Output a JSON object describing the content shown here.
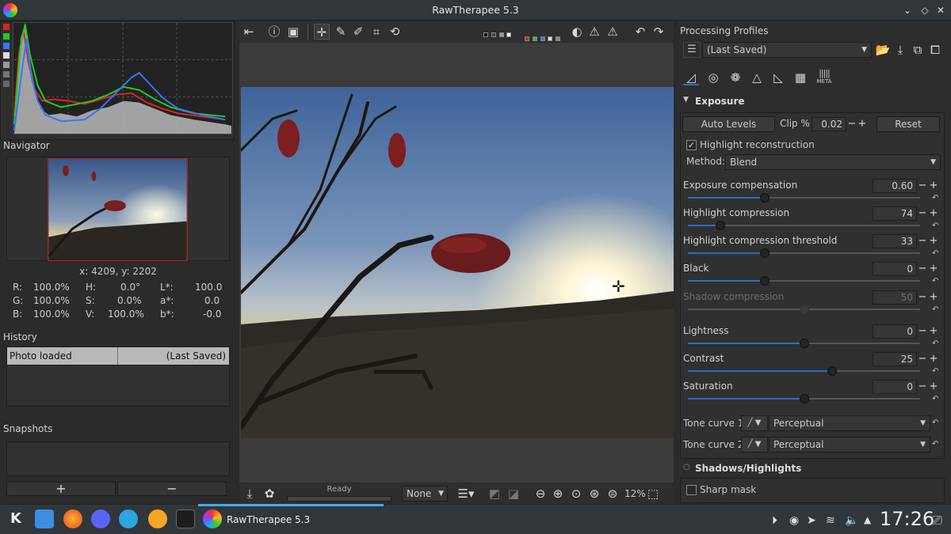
{
  "window": {
    "title": "RawTherapee 5.3"
  },
  "left": {
    "navigator_label": "Navigator",
    "coords": "x: 4209, y: 2202",
    "info": {
      "r_label": "R:",
      "r_val": "100.0%",
      "g_label": "G:",
      "g_val": "100.0%",
      "b_label": "B:",
      "b_val": "100.0%",
      "h_label": "H:",
      "h_val": "0.0°",
      "s_label": "S:",
      "s_val": "0.0%",
      "v_label": "V:",
      "v_val": "100.0%",
      "l_label": "L*:",
      "l_val": "100.0",
      "a_label": "a*:",
      "a_val": "0.0",
      "bb_label": "b*:",
      "bb_val": "-0.0"
    },
    "history_label": "History",
    "history_rows": [
      {
        "name": "Photo loaded",
        "profile": "(Last Saved)"
      }
    ],
    "snapshots_label": "Snapshots",
    "snap_add": "+",
    "snap_remove": "−"
  },
  "center": {
    "status": "Ready",
    "filter_select": "None",
    "zoom": "12%"
  },
  "right": {
    "profiles_label": "Processing Profiles",
    "profile_value": "(Last Saved)",
    "exposure_label": "Exposure",
    "auto_levels": "Auto Levels",
    "clip_label": "Clip %",
    "clip_value": "0.02",
    "reset_label": "Reset",
    "highlight_recon": "Highlight reconstruction",
    "method_label": "Method:",
    "method_value": "Blend",
    "sliders": [
      {
        "label": "Exposure compensation",
        "value": "0.60",
        "fraction": 0.33,
        "disabled": false
      },
      {
        "label": "Highlight compression",
        "value": "74",
        "fraction": 0.14,
        "disabled": false
      },
      {
        "label": "Highlight compression threshold",
        "value": "33",
        "fraction": 0.33,
        "disabled": false
      },
      {
        "label": "Black",
        "value": "0",
        "fraction": 0.33,
        "disabled": false
      },
      {
        "label": "Shadow compression",
        "value": "50",
        "fraction": 0.5,
        "disabled": true
      },
      {
        "label": "Lightness",
        "value": "0",
        "fraction": 0.5,
        "disabled": false
      },
      {
        "label": "Contrast",
        "value": "25",
        "fraction": 0.62,
        "disabled": false
      },
      {
        "label": "Saturation",
        "value": "0",
        "fraction": 0.5,
        "disabled": false
      }
    ],
    "tone_curve_1": "Tone curve 1:",
    "tone_curve_2": "Tone curve 2:",
    "tone_mode_1": "Perceptual",
    "tone_mode_2": "Perceptual",
    "shadows_label": "Shadows/Highlights",
    "sharp_mask": "Sharp mask",
    "meta_tab": "META"
  },
  "taskbar": {
    "app_label": "RawTherapee 5.3",
    "clock": "17:26"
  }
}
